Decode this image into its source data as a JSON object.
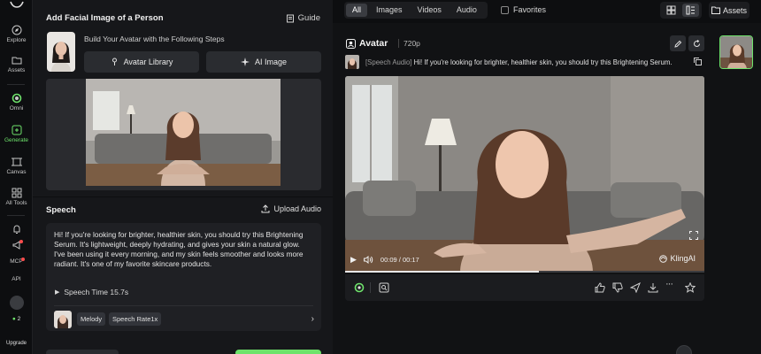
{
  "colors": {
    "accent": "#6ee36b",
    "panel_bg": "#16171a",
    "app_bg": "#0d0e10"
  },
  "rail": {
    "items": [
      {
        "label": "Explore",
        "icon": "compass-icon"
      },
      {
        "label": "Assets",
        "icon": "folder-icon"
      },
      {
        "label": "Omni",
        "icon": "omni-icon"
      },
      {
        "label": "Generate",
        "icon": "generate-icon"
      },
      {
        "label": "Canvas",
        "icon": "canvas-icon"
      },
      {
        "label": "All Tools",
        "icon": "grid-icon"
      },
      {
        "label": "MCP",
        "icon": "mcp-icon"
      },
      {
        "label": "API",
        "icon": "api-icon"
      }
    ],
    "credits": "2",
    "upgrade": "Upgrade"
  },
  "panel": {
    "title": "Add Facial Image of a Person",
    "guide": "Guide",
    "steps_text": "Build Your Avatar with the Following Steps",
    "avatar_library": "Avatar Library",
    "ai_image": "AI Image",
    "speech_title": "Speech",
    "upload_audio": "Upload Audio",
    "speech_text": "Hi! If you're looking for brighter, healthier skin, you should try this Brightening Serum. It's lightweight, deeply hydrating, and gives your skin a natural glow. I've been using it every morning, and my skin feels smoother and looks more radiant. It's one of my favorite skincare products.",
    "speech_time": "Speech Time 15.7s",
    "voice_chip": "Melody",
    "rate_chip": "Speech Rate1x"
  },
  "topbar": {
    "tabs": [
      "All",
      "Images",
      "Videos",
      "Audio"
    ],
    "active_tab": "All",
    "favorites": "Favorites",
    "assets": "Assets"
  },
  "card": {
    "title": "Avatar",
    "resolution": "720p",
    "subtitle_label": "[Speech Audio]",
    "subtitle_text": "Hi! If you're looking for brighter, healthier skin, you should try this Brightening Serum.",
    "time": "00:09 / 00:17",
    "progress": 0.54,
    "watermark": "KlingAI"
  }
}
